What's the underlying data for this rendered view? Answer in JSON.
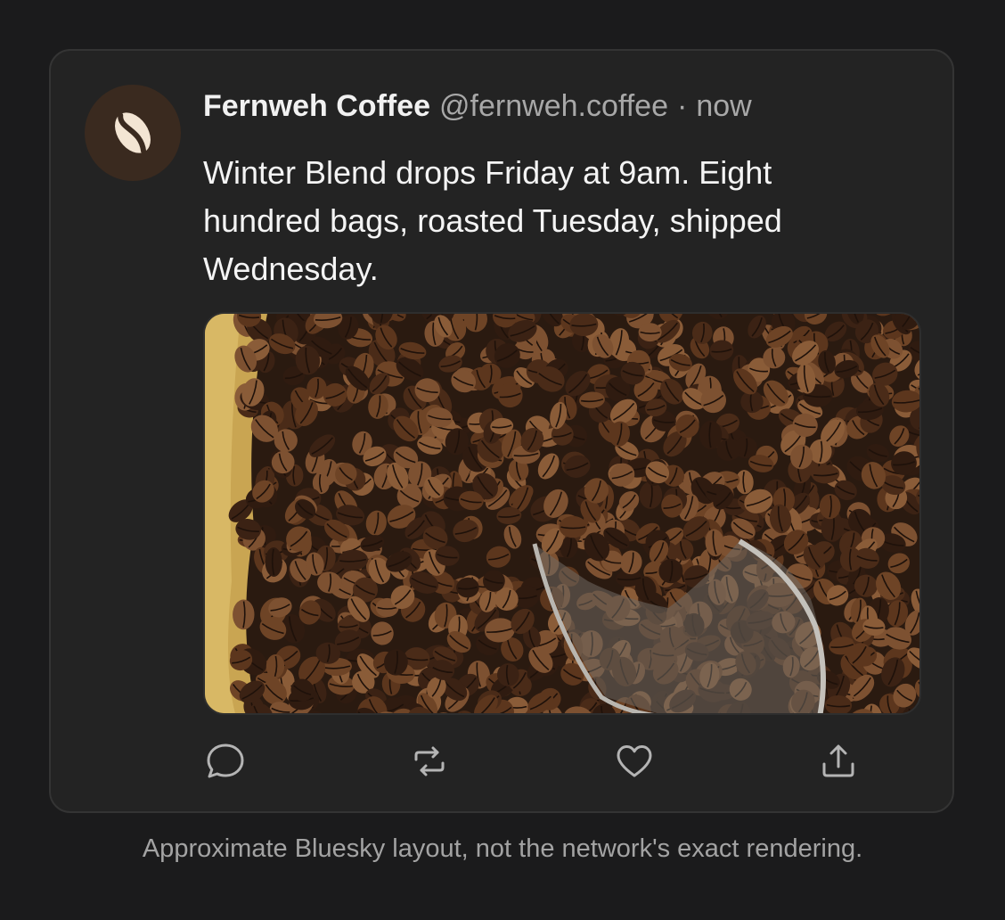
{
  "post": {
    "display_name": "Fernweh Coffee",
    "handle": "@fernweh.coffee",
    "separator": "·",
    "timestamp": "now",
    "text": "Winter Blend drops Friday at 9am. Eight hundred bags, roasted Tuesday, shipped Wednesday.",
    "avatar_icon": "coffee-bean-icon",
    "media_description_icon": "coffee-beans-photo"
  },
  "actions": [
    {
      "name": "reply",
      "icon": "chat-bubble-icon"
    },
    {
      "name": "repost",
      "icon": "repost-icon"
    },
    {
      "name": "like",
      "icon": "heart-icon"
    },
    {
      "name": "share",
      "icon": "share-icon"
    }
  ],
  "footnote": "Approximate Bluesky layout, not the network's exact rendering.",
  "colors": {
    "page_background": "#1b1b1c",
    "card_background": "#232323",
    "card_border": "#343434",
    "avatar_background": "#3a2a1f",
    "bean_color": "#f3e5d3",
    "icon_color": "#b4b4b4",
    "text_primary": "#f1f1f1",
    "text_secondary": "#a8a8a8"
  }
}
